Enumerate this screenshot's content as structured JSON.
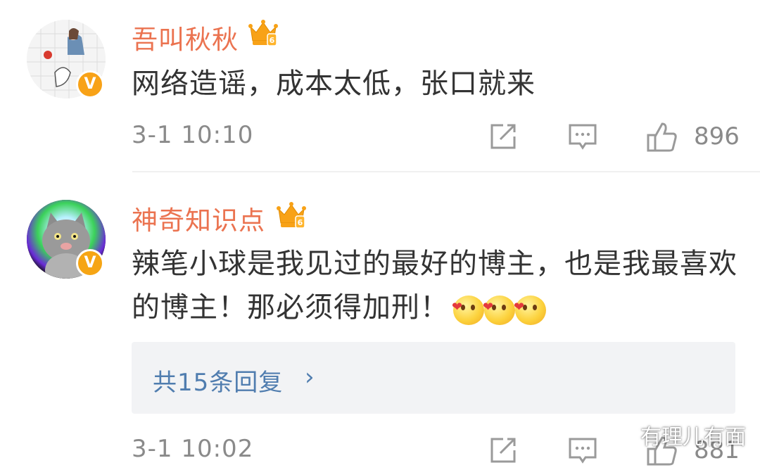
{
  "comments": [
    {
      "username": "吾叫秋秋",
      "text": "网络造谣，成本太低，张口就来",
      "time": "3-1 10:10",
      "likes": "896",
      "vip_level": "6",
      "badge": "V",
      "emojis": []
    },
    {
      "username": "神奇知识点",
      "text": "辣笔小球是我见过的最好的博主，也是我最喜欢的博主！那必须得加刑！",
      "time": "3-1 10:02",
      "likes": "881",
      "vip_level": "6",
      "badge": "V",
      "emojis": [
        "heart-smile-emoji",
        "heart-smile-emoji",
        "heart-smile-emoji"
      ],
      "replies_label": "共15条回复",
      "replies_chevron": "›"
    }
  ],
  "watermark": "有理儿有面",
  "colors": {
    "username": "#eb7350",
    "text": "#333333",
    "meta": "#8a8a8a",
    "link": "#507daf",
    "badge": "#f8a217",
    "reply_bg": "#f2f3f5"
  },
  "icons": [
    "share-icon",
    "comment-icon",
    "like-icon",
    "crown-vip-icon",
    "verified-badge-icon",
    "wechat-watermark-icon"
  ]
}
